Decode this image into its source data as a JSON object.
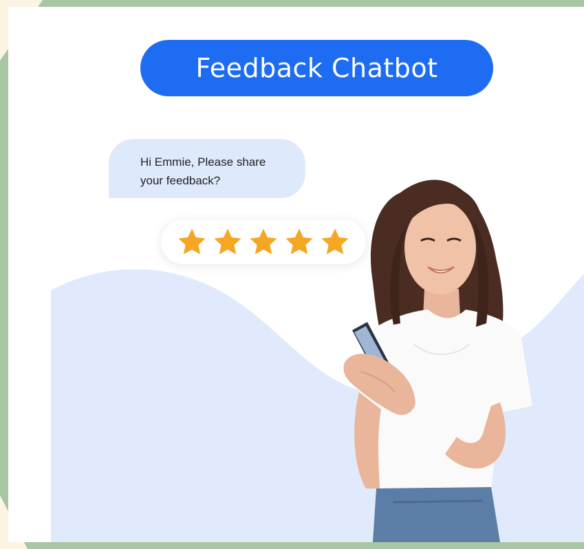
{
  "header": {
    "title": "Feedback Chatbot"
  },
  "chat": {
    "message_line1": "Hi Emmie, Please share",
    "message_line2": "your feedback?"
  },
  "rating": {
    "value": 5,
    "max": 5,
    "star_icon": "star-icon"
  },
  "colors": {
    "brand_blue": "#1e6cf2",
    "bubble": "#dfe9fc",
    "wave": "#e0eafc",
    "star": "#f5a623",
    "frame_green": "#a9c6a3"
  }
}
